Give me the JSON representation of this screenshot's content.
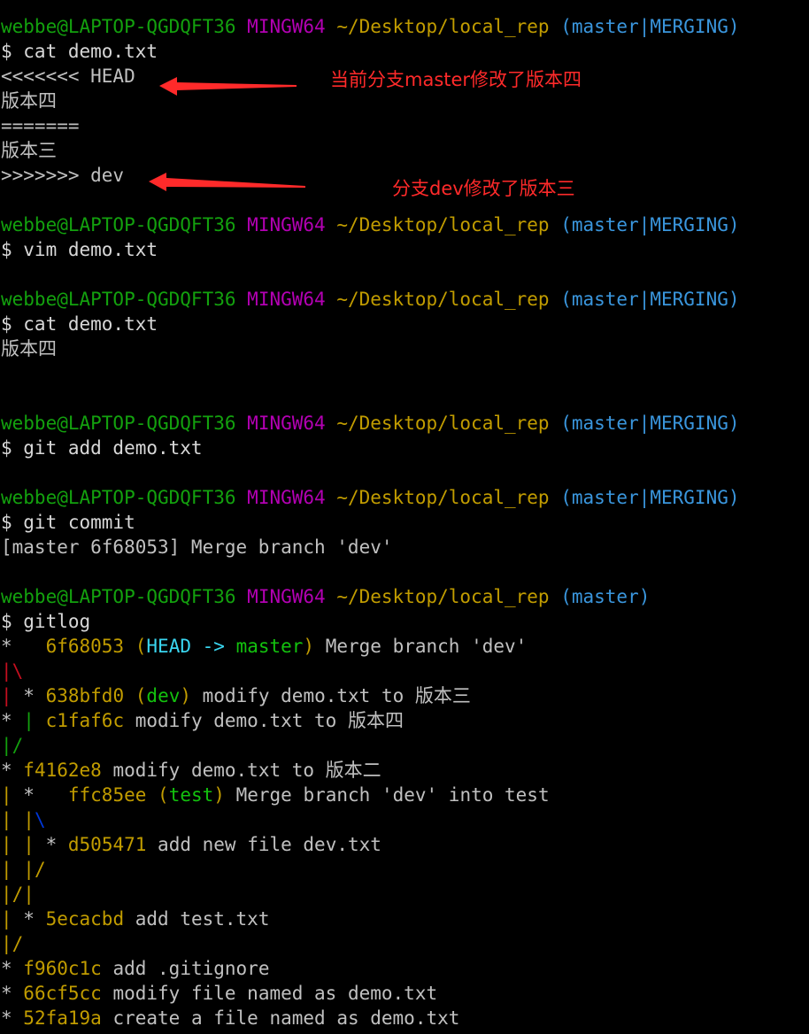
{
  "prompt": {
    "user_host": "webbe@LAPTOP-QGDQFT36",
    "shell": "MINGW64",
    "path": "~/Desktop/local_rep",
    "branch_merging": "(master|MERGING)",
    "branch_master": "(master)"
  },
  "session": {
    "cmd1": "$ cat demo.txt",
    "out1": [
      "<<<<<<< HEAD",
      "版本四",
      "=======",
      "版本三",
      ">>>>>>> dev"
    ],
    "cmd2": "$ vim demo.txt",
    "cmd3": "$ cat demo.txt",
    "out3": "版本四",
    "cmd4": "$ git add demo.txt",
    "cmd5": "$ git commit",
    "out5": "[master 6f68053] Merge branch 'dev'",
    "cmd6": "$ gitlog"
  },
  "annotations": {
    "head_note": "当前分支master修改了版本四",
    "dev_note": "分支dev修改了版本三"
  },
  "log": {
    "c1": {
      "graph": "*   ",
      "hash": "6f68053",
      "refs_open": "(",
      "ref_head": "HEAD -> ",
      "ref_master": "master",
      "refs_close": ")",
      "msg": " Merge branch 'dev'"
    },
    "g1": "|\\",
    "c2": {
      "graph_a": "| ",
      "graph_b": "* ",
      "hash": "638bfd0",
      "ref_open": "(",
      "ref": "dev",
      "ref_close": ")",
      "msg": " modify demo.txt to 版本三"
    },
    "c3": {
      "graph_a": "* ",
      "graph_b": "| ",
      "hash": "c1faf6c",
      "msg": " modify demo.txt to 版本四"
    },
    "g2": "|/",
    "c4": {
      "graph": "* ",
      "hash": "f4162e8",
      "msg": " modify demo.txt to 版本二"
    },
    "c5": {
      "graph_a": "| ",
      "graph_b": "*   ",
      "hash": "ffc85ee",
      "ref_open": "(",
      "ref": "test",
      "ref_close": ")",
      "msg": " Merge branch 'dev' into test"
    },
    "g3": {
      "a": "| ",
      "b": "|",
      "c": "\\"
    },
    "c6": {
      "graph_a": "| ",
      "graph_b": "| ",
      "graph_c": "* ",
      "hash": "d505471",
      "msg": " add new file dev.txt"
    },
    "g4": {
      "a": "| ",
      "b": "|/"
    },
    "g5": {
      "a": "|/",
      "b": "|"
    },
    "c7": {
      "graph_a": "| ",
      "graph_b": "* ",
      "hash": "5ecacbd",
      "msg": " add test.txt"
    },
    "g6": "|/",
    "c8": {
      "graph": "* ",
      "hash": "f960c1c",
      "msg": " add .gitignore"
    },
    "c9": {
      "graph": "* ",
      "hash": "66cf5cc",
      "msg": " modify file named as demo.txt"
    },
    "c10": {
      "graph": "* ",
      "hash": "52fa19a",
      "msg": " create a file named as demo.txt"
    }
  }
}
